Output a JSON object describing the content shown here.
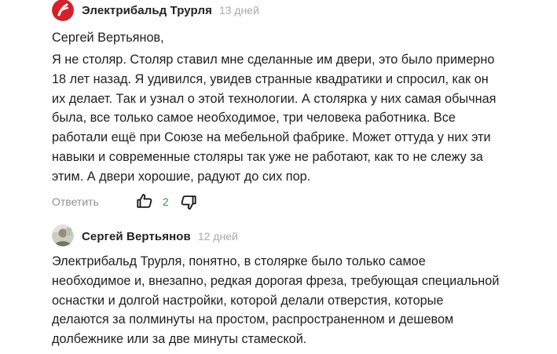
{
  "comments": [
    {
      "author": "Электрибальд Трурля",
      "time": "13 дней",
      "salutation": "Сергей Вертьянов,",
      "lines": [
        "Я не столяр. Столяр ставил мне сделанные им двери, это было примерно",
        "18 лет назад. Я удивился, увидев странные квадратики и спросил, как он",
        "их делает. Так и узнал о этой технологии. А столярка у них самая обычная",
        "была, все только самое необходимое, три человека работника. Все",
        "работали ещё при Союзе на мебельной фабрике. Может оттуда у них эти",
        "навыки и современные столяры так уже не работают, как то не слежу за",
        "этим. А двери хорошие, радуют до сих пор."
      ],
      "reply_label": "Ответить",
      "likes": "2"
    },
    {
      "author": "Сергей Вертьянов",
      "time": "12 дней",
      "lines": [
        "Электрибальд Трурля, понятно, в столярке было только самое",
        "необходимое и, внезапно, редкая дорогая фреза, требующая специальной",
        "оснастки и долгой настройки, которой делали отверстия, которые",
        "делаются за полминуты на простом, распространенном и дешевом",
        "долбежнике или за две минуты стамеской."
      ]
    }
  ],
  "colors": {
    "logo_red": "#d6202b",
    "like_green": "#2e9b3d",
    "muted": "#8f8f8f"
  },
  "icons": {
    "author1_avatar": "red-circle-logo-icon",
    "author2_avatar": "user-photo-avatar",
    "like": "thumbs-up-icon",
    "dislike": "thumbs-down-icon"
  }
}
